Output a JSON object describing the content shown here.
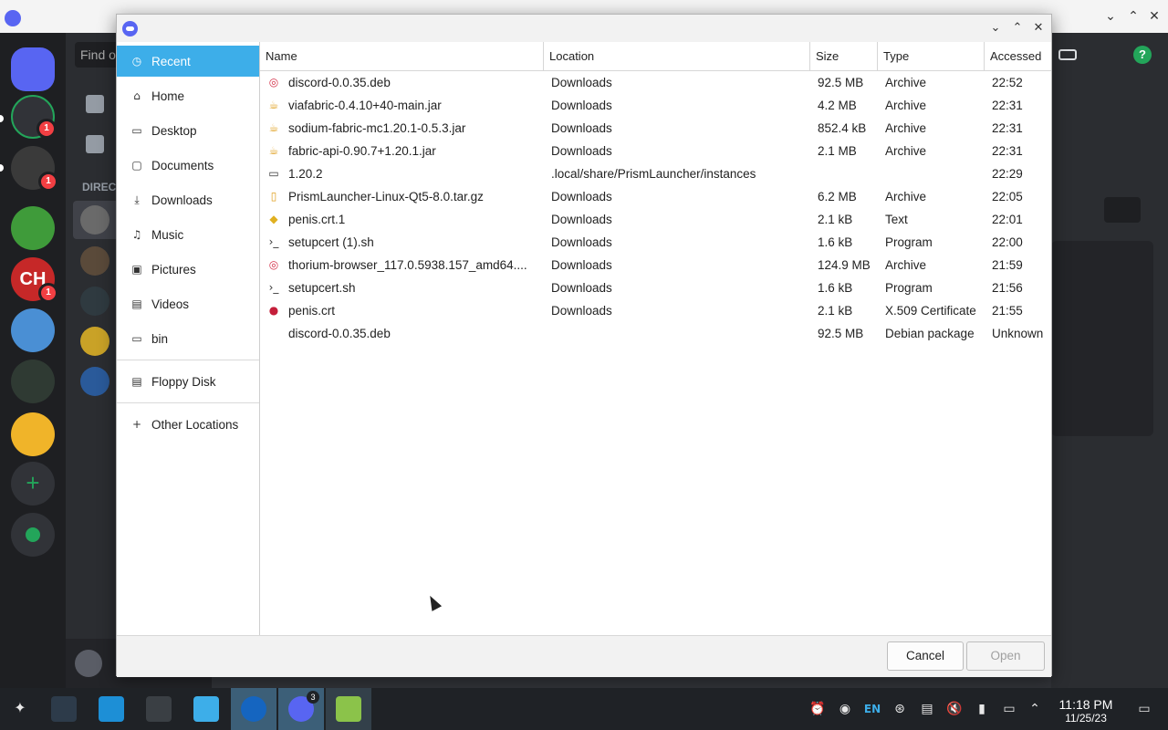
{
  "discord": {
    "find_placeholder": "Find or",
    "direct_label": "DIRECT",
    "servers": [
      {
        "name": "add",
        "badge": "1"
      },
      {
        "name": "avatar-glasses",
        "badge": "1"
      },
      {
        "name": "green-art",
        "badge": ""
      },
      {
        "name": "ch",
        "label": "CH",
        "badge": "1"
      },
      {
        "name": "anime",
        "badge": ""
      },
      {
        "name": "dark",
        "badge": ""
      },
      {
        "name": "hand",
        "badge": ""
      }
    ]
  },
  "dialog": {
    "close_icon": "✕",
    "sidebar": [
      {
        "label": "Recent",
        "icon": "◷",
        "selected": true
      },
      {
        "label": "Home",
        "icon": "⌂"
      },
      {
        "label": "Desktop",
        "icon": "▭"
      },
      {
        "label": "Documents",
        "icon": "▢"
      },
      {
        "label": "Downloads",
        "icon": "⤓"
      },
      {
        "label": "Music",
        "icon": "♫"
      },
      {
        "label": "Pictures",
        "icon": "▣"
      },
      {
        "label": "Videos",
        "icon": "▤"
      },
      {
        "label": "bin",
        "icon": "▭"
      },
      {
        "label": "Floppy Disk",
        "icon": "▤"
      },
      {
        "label": "Other Locations",
        "icon": "+"
      }
    ],
    "columns": {
      "name": "Name",
      "location": "Location",
      "size": "Size",
      "type": "Type",
      "accessed": "Accessed"
    },
    "files": [
      {
        "name": "discord-0.0.35.deb",
        "location": "Downloads",
        "size": "92.5 MB",
        "type": "Archive",
        "accessed": "22:52",
        "icon": "deb"
      },
      {
        "name": "viafabric-0.4.10+40-main.jar",
        "location": "Downloads",
        "size": "4.2 MB",
        "type": "Archive",
        "accessed": "22:31",
        "icon": "jar"
      },
      {
        "name": "sodium-fabric-mc1.20.1-0.5.3.jar",
        "location": "Downloads",
        "size": "852.4 kB",
        "type": "Archive",
        "accessed": "22:31",
        "icon": "jar"
      },
      {
        "name": "fabric-api-0.90.7+1.20.1.jar",
        "location": "Downloads",
        "size": "2.1 MB",
        "type": "Archive",
        "accessed": "22:31",
        "icon": "jar"
      },
      {
        "name": "1.20.2",
        "location": ".local/share/PrismLauncher/instances",
        "size": "",
        "type": "",
        "accessed": "22:29",
        "icon": "folder"
      },
      {
        "name": "PrismLauncher-Linux-Qt5-8.0.tar.gz",
        "location": "Downloads",
        "size": "6.2 MB",
        "type": "Archive",
        "accessed": "22:05",
        "icon": "archive"
      },
      {
        "name": "penis.crt.1",
        "location": "Downloads",
        "size": "2.1 kB",
        "type": "Text",
        "accessed": "22:01",
        "icon": "text"
      },
      {
        "name": "setupcert (1).sh",
        "location": "Downloads",
        "size": "1.6 kB",
        "type": "Program",
        "accessed": "22:00",
        "icon": "script"
      },
      {
        "name": "thorium-browser_117.0.5938.157_amd64....",
        "location": "Downloads",
        "size": "124.9 MB",
        "type": "Archive",
        "accessed": "21:59",
        "icon": "deb"
      },
      {
        "name": "setupcert.sh",
        "location": "Downloads",
        "size": "1.6 kB",
        "type": "Program",
        "accessed": "21:56",
        "icon": "script"
      },
      {
        "name": "penis.crt",
        "location": "Downloads",
        "size": "2.1 kB",
        "type": "X.509 Certificate",
        "accessed": "21:55",
        "icon": "cert"
      },
      {
        "name": "discord-0.0.35.deb",
        "location": "",
        "size": "92.5 MB",
        "type": "Debian package",
        "accessed": "Unknown",
        "icon": "none"
      }
    ],
    "cancel_label": "Cancel",
    "open_label": "Open"
  },
  "taskbar": {
    "lang": "EN",
    "time": "11:18 PM",
    "date": "11/25/23",
    "discord_badge": "3"
  },
  "colors": {
    "selection": "#3daee9",
    "discord_blurple": "#5865f2",
    "jar_icon": "#e0a020",
    "deb_icon": "#d4324a",
    "cert_icon": "#c41e3a"
  }
}
